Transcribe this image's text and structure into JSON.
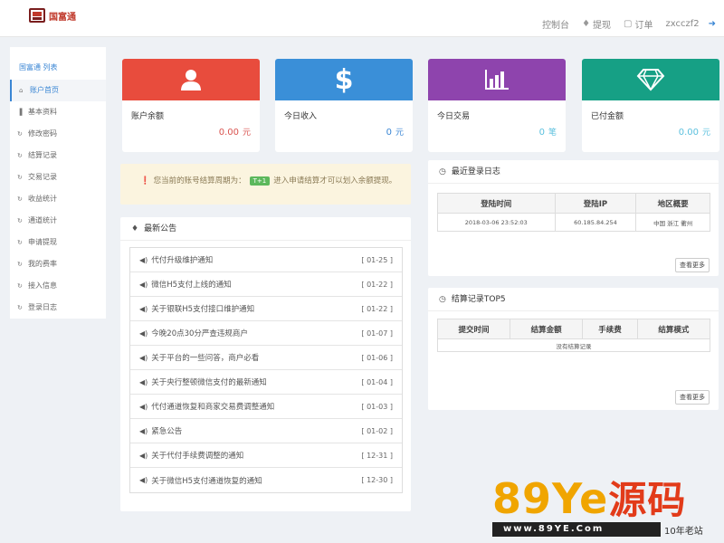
{
  "header": {
    "logo_text": "国富通",
    "nav": {
      "console": "控制台",
      "withdraw": "提现",
      "orders": "订单",
      "username": "zxcczf2"
    }
  },
  "sidebar": {
    "title": "国富通  列表",
    "items": [
      {
        "label": "账户首页",
        "icon": "home-icon",
        "active": true
      },
      {
        "label": "基本资料",
        "icon": "chart-icon"
      },
      {
        "label": "修改密码",
        "icon": "refresh-icon"
      },
      {
        "label": "结算记录",
        "icon": "refresh-icon"
      },
      {
        "label": "交易记录",
        "icon": "refresh-icon"
      },
      {
        "label": "收益统计",
        "icon": "refresh-icon"
      },
      {
        "label": "通道统计",
        "icon": "refresh-icon"
      },
      {
        "label": "申请提现",
        "icon": "refresh-icon"
      },
      {
        "label": "我的费率",
        "icon": "refresh-icon"
      },
      {
        "label": "接入信息",
        "icon": "refresh-icon"
      },
      {
        "label": "登录日志",
        "icon": "refresh-icon"
      }
    ]
  },
  "cards": [
    {
      "label": "账户余额",
      "value": "0.00",
      "unit": "元",
      "color": "#e84c3d",
      "value_color": "#d9534f",
      "icon": "user-icon"
    },
    {
      "label": "今日收入",
      "value": "0",
      "unit": "元",
      "color": "#3a8fd8",
      "value_color": "#3a86d4",
      "icon": "dollar-icon"
    },
    {
      "label": "今日交易",
      "value": "0",
      "unit": "笔",
      "color": "#8e44ad",
      "value_color": "#5bc0de",
      "icon": "bar-chart-icon"
    },
    {
      "label": "已付金额",
      "value": "0.00",
      "unit": "元",
      "color": "#16a085",
      "value_color": "#5bc0de",
      "icon": "diamond-icon"
    }
  ],
  "notice": {
    "text_before": "您当前的账号结算周期为：",
    "tag": "T+1",
    "text_after": "进入申请结算才可以划入余额提现。"
  },
  "announcements": {
    "title": "最新公告",
    "items": [
      {
        "title": "代付升级维护通知",
        "date": "[ 01-25 ]"
      },
      {
        "title": "微信H5支付上线的通知",
        "date": "[ 01-22 ]"
      },
      {
        "title": "关于银联H5支付接口维护通知",
        "date": "[ 01-22 ]"
      },
      {
        "title": "今晚20点30分严查违规商户",
        "date": "[ 01-07 ]"
      },
      {
        "title": "关于平台的一些问答，商户必看",
        "date": "[ 01-06 ]"
      },
      {
        "title": "关于央行整顿微信支付的最新通知",
        "date": "[ 01-04 ]"
      },
      {
        "title": "代付通道恢复和商家交易费调整通知",
        "date": "[ 01-03 ]"
      },
      {
        "title": "紧急公告",
        "date": "[ 01-02 ]"
      },
      {
        "title": "关于代付手续费调整的通知",
        "date": "[ 12-31 ]"
      },
      {
        "title": "关于微信H5支付通道恢复的通知",
        "date": "[ 12-30 ]"
      }
    ]
  },
  "login_log": {
    "title": "最近登录日志",
    "columns": [
      "登陆时间",
      "登陆IP",
      "地区概要"
    ],
    "rows": [
      [
        "2018-03-06 23:52:03",
        "60.185.84.254",
        "中国 浙江 衢州"
      ]
    ],
    "more": "查看更多"
  },
  "settle_top": {
    "title": "结算记录TOP5",
    "columns": [
      "提交时间",
      "结算金额",
      "手续费",
      "结算模式"
    ],
    "empty": "没有结算记录",
    "more": "查看更多"
  },
  "watermark": {
    "big": "89Ye",
    "big_cn": "源码",
    "url": "www.89YE.Com",
    "slogan": "10年老站"
  }
}
